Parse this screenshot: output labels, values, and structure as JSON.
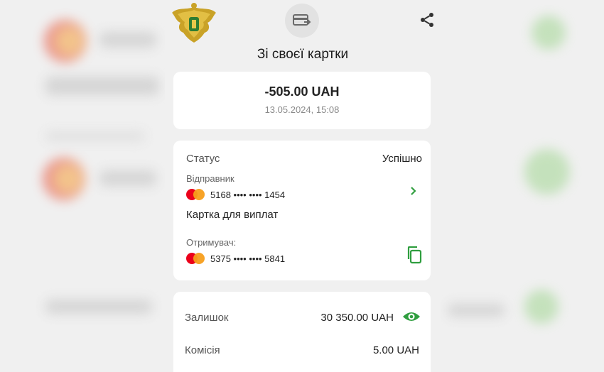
{
  "header": {
    "title": "Зі своєї картки"
  },
  "summary": {
    "amount": "-505.00 UAH",
    "datetime": "13.05.2024, 15:08"
  },
  "details": {
    "status_label": "Статус",
    "status_value": "Успішно",
    "sender_label": "Відправник",
    "sender_card": "5168 •••• •••• 1454",
    "sender_card_name": "Картка для виплат",
    "recipient_label": "Отримувач:",
    "recipient_card": "5375 •••• •••• 5841"
  },
  "balance": {
    "balance_label": "Залишок",
    "balance_value": "30 350.00 UAH",
    "fee_label": "Комісія",
    "fee_value": "5.00 UAH"
  },
  "colors": {
    "accent_green": "#2f9e3f",
    "mastercard_red": "#eb001b",
    "mastercard_yellow": "#f79e1b"
  },
  "icons": [
    "emblem",
    "card-transfer-icon",
    "share-icon",
    "chevron-right-icon",
    "copy-icon",
    "eye-icon",
    "mastercard-icon"
  ]
}
